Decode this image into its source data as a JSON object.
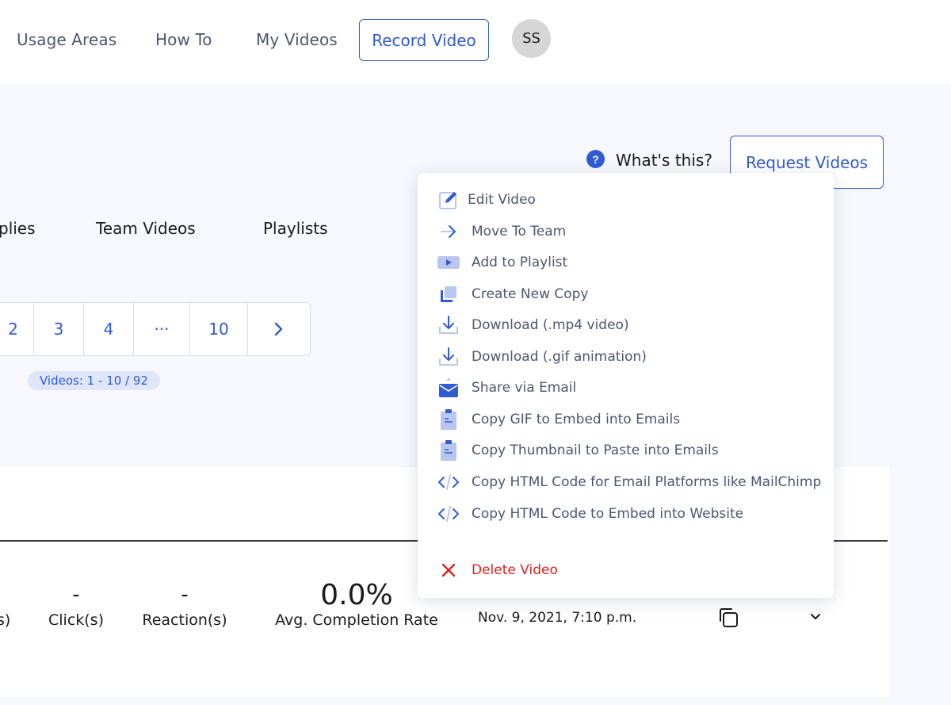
{
  "nav": {
    "links": [
      "Usage Areas",
      "How To",
      "My Videos"
    ],
    "record_label": "Record Video",
    "avatar_initials": "SS"
  },
  "header": {
    "whats_this": "What's this?",
    "help_glyph": "?",
    "request_label": "Request Videos"
  },
  "tabs": [
    "plies",
    "Team Videos",
    "Playlists"
  ],
  "pagination": {
    "pages": [
      "2",
      "3",
      "4",
      "···",
      "10",
      "›"
    ],
    "count_label": "Videos: 1 - 10 / 92"
  },
  "row": {
    "views_label_fragment": "s)",
    "clicks_value": "-",
    "clicks_label": "Click(s)",
    "reactions_value": "-",
    "reactions_label": "Reaction(s)",
    "completion_value": "0.0%",
    "completion_label": "Avg. Completion Rate",
    "date": "Nov. 9, 2021, 7:10 p.m."
  },
  "menu": {
    "items": [
      {
        "label": "Edit Video",
        "icon": "edit-icon"
      },
      {
        "label": "Move To Team",
        "icon": "arrow-right-icon"
      },
      {
        "label": "Add to Playlist",
        "icon": "playlist-icon"
      },
      {
        "label": "Create New Copy",
        "icon": "duplicate-icon"
      },
      {
        "label": "Download (.mp4 video)",
        "icon": "download-icon"
      },
      {
        "label": "Download (.gif animation)",
        "icon": "download-icon"
      },
      {
        "label": "Share via Email",
        "icon": "email-icon"
      },
      {
        "label": "Copy GIF to Embed into Emails",
        "icon": "clipboard-icon"
      },
      {
        "label": "Copy Thumbnail to Paste into Emails",
        "icon": "clipboard-icon"
      },
      {
        "label": "Copy HTML Code for Email Platforms like MailChimp",
        "icon": "code-icon"
      },
      {
        "label": "Copy HTML Code to Embed into Website",
        "icon": "code-icon"
      },
      {
        "label": "Delete Video",
        "icon": "close-icon"
      }
    ]
  },
  "colors": {
    "accent": "#2f5bd3",
    "menu_text": "#4a5670",
    "danger": "#e02020",
    "page_bg": "#f7f8fd"
  }
}
